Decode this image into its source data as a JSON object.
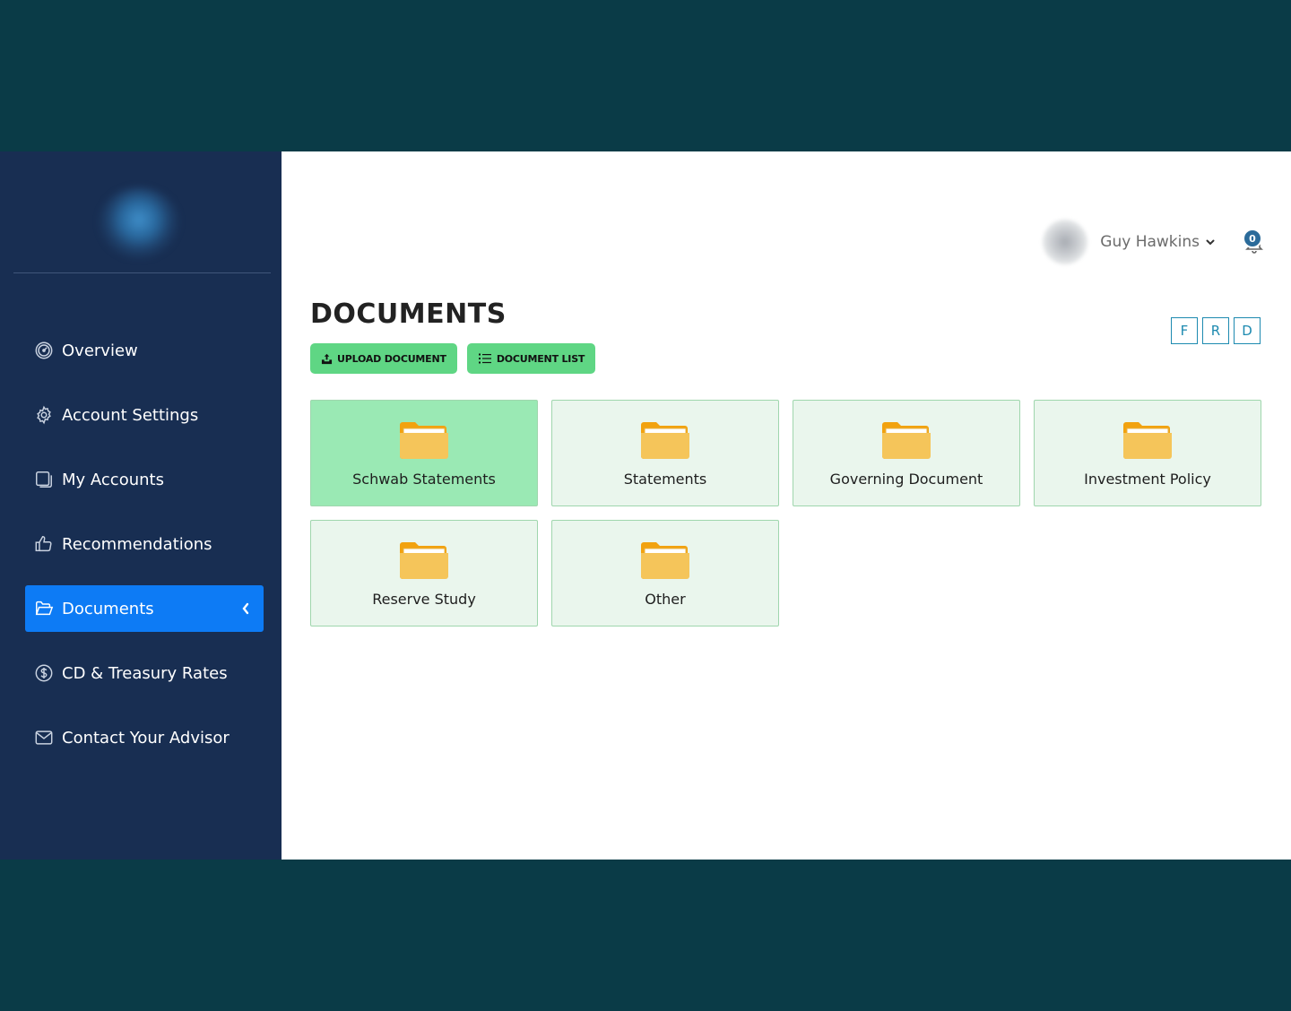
{
  "sidebar": {
    "items": [
      {
        "label": "Overview",
        "icon": "gauge-icon"
      },
      {
        "label": "Account Settings",
        "icon": "gear-icon"
      },
      {
        "label": "My Accounts",
        "icon": "accounts-icon"
      },
      {
        "label": "Recommendations",
        "icon": "thumbs-up-icon"
      },
      {
        "label": "Documents",
        "icon": "folder-open-icon",
        "active": true
      },
      {
        "label": "CD & Treasury Rates",
        "icon": "dollar-circle-icon"
      },
      {
        "label": "Contact Your Advisor",
        "icon": "envelope-icon"
      }
    ]
  },
  "header": {
    "user_name": "Guy Hawkins",
    "notification_count": "0"
  },
  "page": {
    "title": "DOCUMENTS",
    "upload_label": "UPLOAD DOCUMENT",
    "list_label": "DOCUMENT LIST",
    "toggles": [
      "F",
      "R",
      "D"
    ]
  },
  "folders": [
    {
      "label": "Schwab Statements",
      "active": true
    },
    {
      "label": "Statements"
    },
    {
      "label": "Governing Document"
    },
    {
      "label": "Investment Policy"
    },
    {
      "label": "Reserve Study"
    },
    {
      "label": "Other"
    }
  ],
  "colors": {
    "sidebar_bg": "#182e52",
    "active_nav": "#0d7bf5",
    "button_green": "#5fd684",
    "folder_yellow": "#f5c55a",
    "outer_bg": "#0a3b47"
  }
}
